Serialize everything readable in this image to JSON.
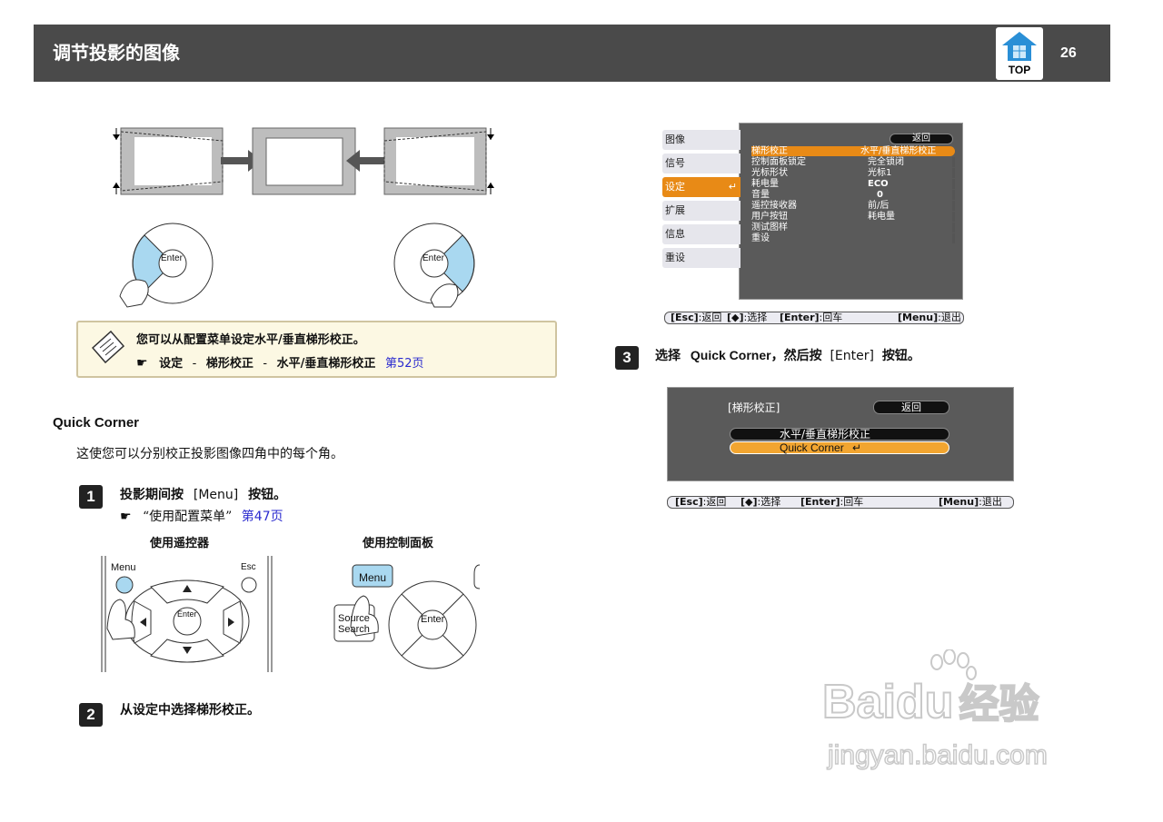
{
  "header": {
    "title": "调节投影的图像",
    "top_logo_label": "TOP",
    "page_number": "26"
  },
  "keystone_figure": {
    "enter_label": "Enter"
  },
  "note": {
    "line1": "您可以从配置菜单设定水平/垂直梯形校正。",
    "path": [
      "设定",
      "梯形校正",
      "水平/垂直梯形校正"
    ],
    "separator": "-",
    "page_ref": "第52页"
  },
  "quick_corner": {
    "heading": "Quick Corner",
    "description": "这使您可以分别校正投影图像四角中的每个角。"
  },
  "step1": {
    "number": "1",
    "text_before": "投影期间按",
    "key": "[Menu]",
    "text_after": "按钮。",
    "ref_text": "“使用配置菜单”",
    "ref_page": "第47页",
    "remote_label": "使用遥控器",
    "panel_label": "使用控制面板",
    "remote_menu": "Menu",
    "remote_esc": "Esc",
    "remote_enter": "Enter",
    "panel_menu": "Menu",
    "panel_source": "Source",
    "panel_search": "Search",
    "panel_enter": "Enter"
  },
  "step2": {
    "number": "2",
    "text": "从设定中选择梯形校正。"
  },
  "menu_screen": {
    "tabs": [
      "图像",
      "信号",
      "设定",
      "扩展",
      "信息",
      "重设"
    ],
    "selected_tab": 2,
    "back": "返回",
    "rows": [
      {
        "label": "梯形校正",
        "value": "水平/垂直梯形校正"
      },
      {
        "label": "控制面板锁定",
        "value": "完全锁闭"
      },
      {
        "label": "光标形状",
        "value": "光标1"
      },
      {
        "label": "耗电量",
        "value": "ECO"
      },
      {
        "label": "音量",
        "value": "0"
      },
      {
        "label": "遥控接收器",
        "value": "前/后"
      },
      {
        "label": "用户按钮",
        "value": "耗电量"
      },
      {
        "label": "测试图样",
        "value": ""
      },
      {
        "label": "重设",
        "value": ""
      }
    ],
    "status": {
      "esc": "[Esc]",
      "esc_t": ":返回",
      "sel": "[◆]",
      "sel_t": ":选择",
      "enter": "[Enter]",
      "enter_t": ":回车",
      "menu": "[Menu]",
      "menu_t": ":退出"
    }
  },
  "step3": {
    "number": "3",
    "text_before": "选择",
    "item": "Quick Corner",
    "text_mid": "，然后按",
    "key": "[Enter]",
    "text_after": "按钮。"
  },
  "keystone_screen": {
    "title": "[梯形校正]",
    "back": "返回",
    "options": [
      "水平/垂直梯形校正",
      "Quick Corner"
    ],
    "status": {
      "esc": "[Esc]",
      "esc_t": ":返回",
      "sel": "[◆]",
      "sel_t": ":选择",
      "enter": "[Enter]",
      "enter_t": ":回车",
      "menu": "[Menu]",
      "menu_t": ":退出"
    }
  },
  "watermark": {
    "brand": "Bai",
    "brand2": "du",
    "cn": "经验",
    "url": "jingyan.baidu.com"
  },
  "colors": {
    "header_bg": "#4a4a4a",
    "accent_orange": "#e88a16",
    "link": "#2b2bcf",
    "note_bg": "#fcf8e3",
    "highlight_blue": "#a9d8f0"
  }
}
